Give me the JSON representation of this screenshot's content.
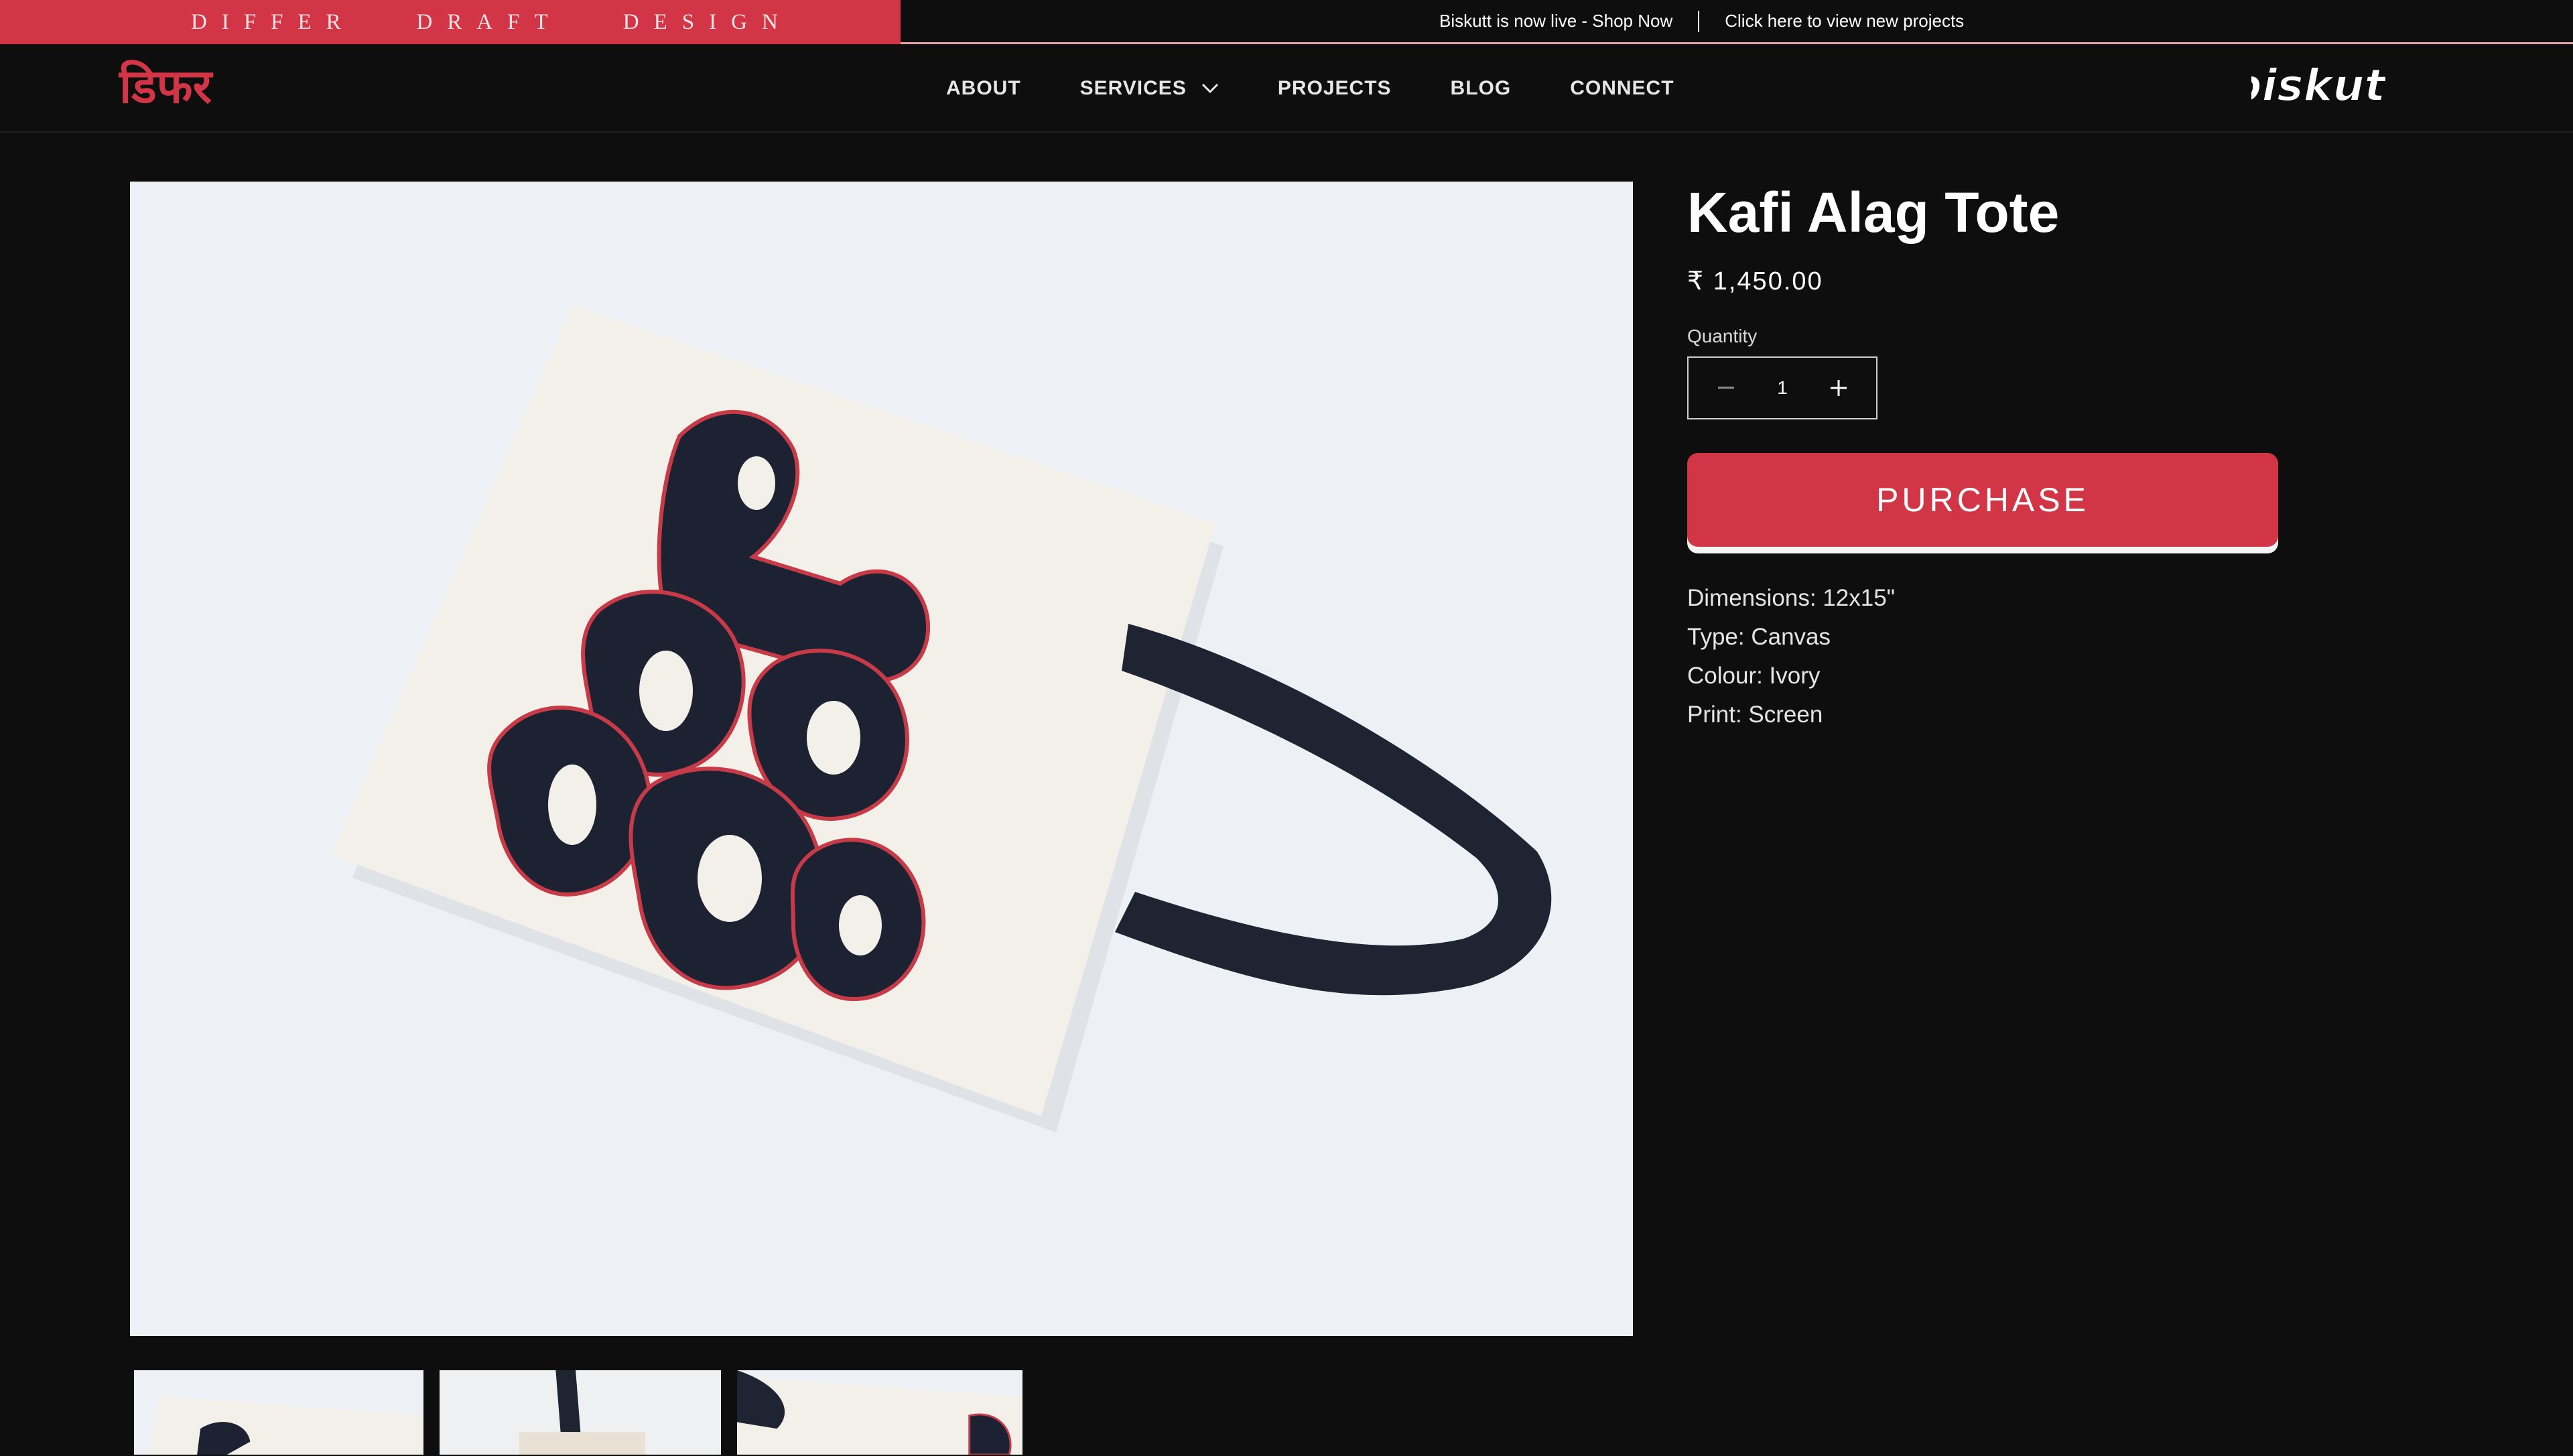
{
  "announcement": {
    "brand_text": "DIFFER   DRAFT   DESIGN",
    "link_shop": "Biskutt is now live - Shop Now",
    "link_projects": "Click here to view new projects",
    "accent_color": "#d23545"
  },
  "header": {
    "logo_left": "डिफर",
    "logo_right": "biskutt",
    "nav": {
      "about": "ABOUT",
      "services": "SERVICES",
      "projects": "PROJECTS",
      "blog": "BLOG",
      "connect": "CONNECT"
    }
  },
  "product": {
    "title": "Kafi Alag Tote",
    "price": "₹ 1,450.00",
    "quantity_label": "Quantity",
    "quantity_value": "1",
    "purchase_label": "PURCHASE",
    "specs": [
      "Dimensions: 12x15\"",
      "Type: Canvas",
      "Colour: Ivory",
      "Print: Screen"
    ]
  },
  "gallery": {
    "thumbnails": [
      "thumbnail-1",
      "thumbnail-2",
      "thumbnail-3"
    ]
  }
}
